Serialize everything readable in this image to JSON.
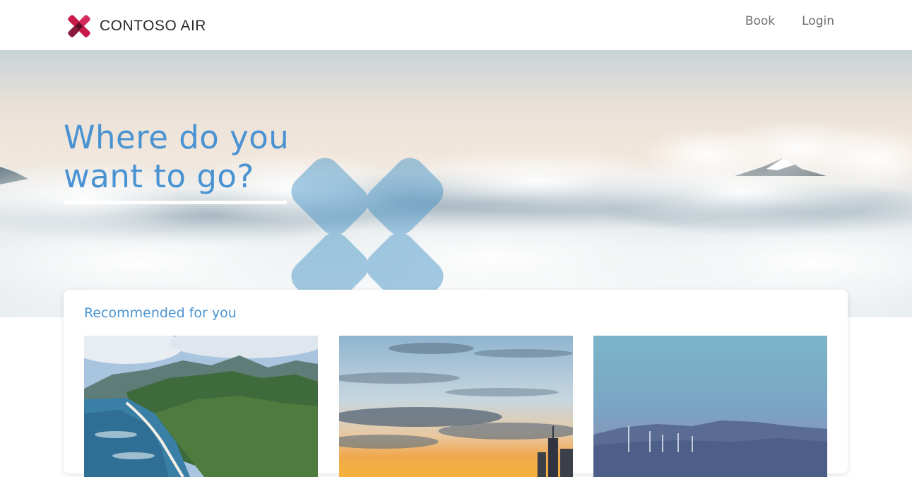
{
  "brand": {
    "name": "CONTOSO AIR",
    "colors": {
      "mark_primary": "#c8194a",
      "mark_secondary": "#8a1a3c",
      "accent_blue": "#4a93d2"
    }
  },
  "nav": {
    "items": [
      {
        "label": "Book"
      },
      {
        "label": "Login"
      }
    ]
  },
  "hero": {
    "title": "Where do you want to go?",
    "background": "clouds-above-mountains-image"
  },
  "recommended": {
    "title": "Recommended for you",
    "destinations": [
      {
        "image": "tropical-coastline-mountains-photo"
      },
      {
        "image": "city-skyline-sunset-photo"
      },
      {
        "image": "valley-wind-turbines-photo"
      }
    ]
  }
}
